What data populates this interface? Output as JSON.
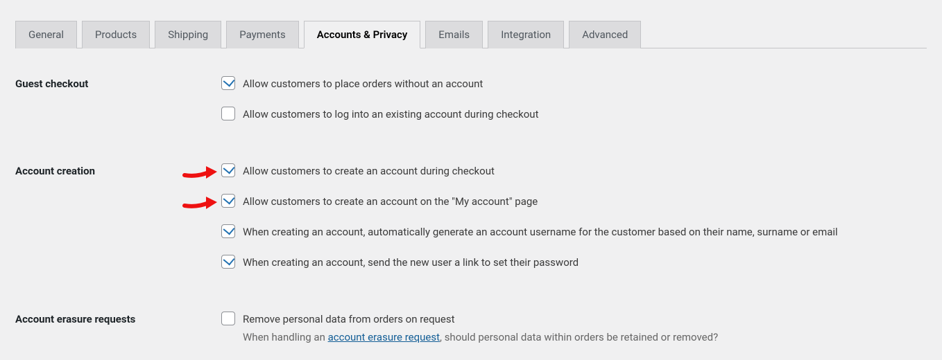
{
  "tabs": [
    {
      "id": "general",
      "label": "General",
      "active": false
    },
    {
      "id": "products",
      "label": "Products",
      "active": false
    },
    {
      "id": "shipping",
      "label": "Shipping",
      "active": false
    },
    {
      "id": "payments",
      "label": "Payments",
      "active": false
    },
    {
      "id": "accounts",
      "label": "Accounts & Privacy",
      "active": true
    },
    {
      "id": "emails",
      "label": "Emails",
      "active": false
    },
    {
      "id": "integration",
      "label": "Integration",
      "active": false
    },
    {
      "id": "advanced",
      "label": "Advanced",
      "active": false
    }
  ],
  "sections": {
    "guest_checkout": {
      "label": "Guest checkout",
      "opt1": {
        "label": "Allow customers to place orders without an account",
        "checked": true
      },
      "opt2": {
        "label": "Allow customers to log into an existing account during checkout",
        "checked": false
      }
    },
    "account_creation": {
      "label": "Account creation",
      "opt1": {
        "label": "Allow customers to create an account during checkout",
        "checked": true
      },
      "opt2": {
        "label": "Allow customers to create an account on the \"My account\" page",
        "checked": true
      },
      "opt3": {
        "label": "When creating an account, automatically generate an account username for the customer based on their name, surname or email",
        "checked": true
      },
      "opt4": {
        "label": "When creating an account, send the new user a link to set their password",
        "checked": true
      }
    },
    "account_erasure": {
      "label": "Account erasure requests",
      "opt1": {
        "label": "Remove personal data from orders on request",
        "checked": false
      },
      "desc_before": "When handling an ",
      "desc_link": "account erasure request",
      "desc_after": ", should personal data within orders be retained or removed?"
    }
  }
}
